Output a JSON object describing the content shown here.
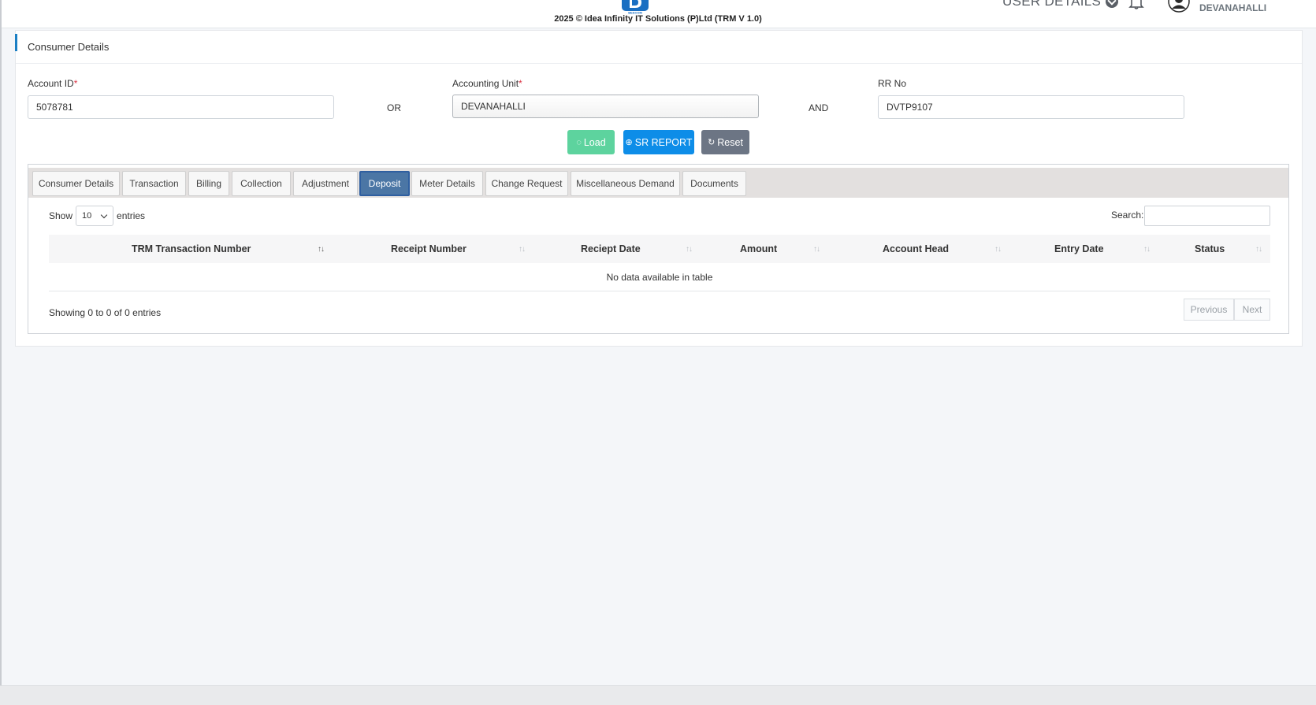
{
  "header": {
    "user_details_label": "USER DETAILS",
    "user_location": "DEVANAHALLI",
    "logo_text": "BESCOM"
  },
  "card": {
    "title": "Consumer Details",
    "account_id": {
      "label": "Account ID",
      "required": "*",
      "value": "5078781"
    },
    "or_word": "OR",
    "accounting_unit": {
      "label": "Accounting Unit",
      "required": "*",
      "value": "DEVANAHALLI"
    },
    "and_word": "AND",
    "rr_no": {
      "label": "RR No",
      "value": "DVTP9107"
    },
    "buttons": {
      "load": "Load",
      "sr_report": "SR REPORT",
      "reset": "Reset"
    }
  },
  "tabs": [
    {
      "label": "Consumer Details"
    },
    {
      "label": "Transaction"
    },
    {
      "label": "Billing"
    },
    {
      "label": "Collection"
    },
    {
      "label": "Adjustment"
    },
    {
      "label": "Deposit",
      "active": true
    },
    {
      "label": "Meter Details"
    },
    {
      "label": "Change Request"
    },
    {
      "label": "Miscellaneous Demand"
    },
    {
      "label": "Documents"
    }
  ],
  "table": {
    "show_label": "Show",
    "entries_value": "10",
    "entries_label": "entries",
    "search_label": "Search:",
    "columns": [
      "TRM Transaction Number",
      "Receipt Number",
      "Reciept Date",
      "Amount",
      "Account Head",
      "Entry Date",
      "Status"
    ],
    "empty_message": "No data available in table",
    "info": "Showing 0 to 0 of 0 entries",
    "previous": "Previous",
    "next": "Next"
  },
  "footer": {
    "text": "2025 © Idea Infinity IT Solutions (P)Ltd (TRM V 1.0)"
  },
  "colors": {
    "accent": "#1b7fc4",
    "load_button": "#5dd39e",
    "sr_button": "#0d8de8",
    "reset_button": "#6c7584",
    "active_tab": "#4b76a5"
  }
}
